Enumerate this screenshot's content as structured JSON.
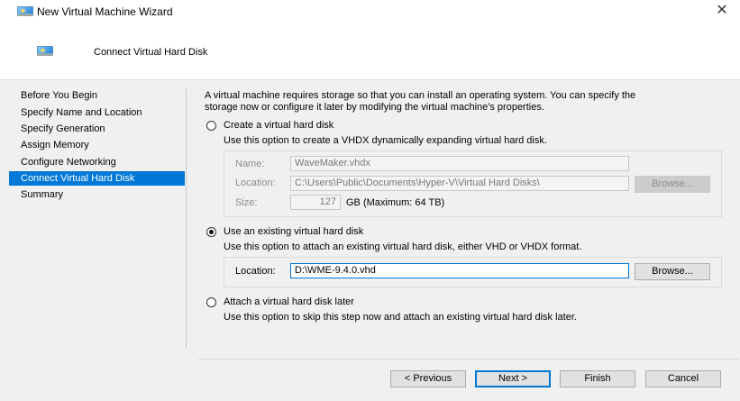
{
  "window": {
    "title": "New Virtual Machine Wizard",
    "close_icon": "close-icon"
  },
  "page_heading": "Connect Virtual Hard Disk",
  "sidebar": {
    "items": [
      {
        "label": "Before You Begin"
      },
      {
        "label": "Specify Name and Location"
      },
      {
        "label": "Specify Generation"
      },
      {
        "label": "Assign Memory"
      },
      {
        "label": "Configure Networking"
      },
      {
        "label": "Connect Virtual Hard Disk",
        "selected": true
      },
      {
        "label": "Summary"
      }
    ]
  },
  "main": {
    "intro_line1": "A virtual machine requires storage so that you can install an operating system. You can specify the",
    "intro_line2": "storage now or configure it later by modifying the virtual machine's properties.",
    "create": {
      "label": "Create a virtual hard disk",
      "selected": false,
      "description": "Use this option to create a VHDX dynamically expanding virtual hard disk.",
      "name_label": "Name:",
      "name_value": "WaveMaker.vhdx",
      "location_label": "Location:",
      "location_value": "C:\\Users\\Public\\Documents\\Hyper-V\\Virtual Hard Disks\\",
      "browse_label": "Browse...",
      "size_label": "Size:",
      "size_value": "127",
      "size_unit": "GB (Maximum: 64 TB)"
    },
    "existing": {
      "label": "Use an existing virtual hard disk",
      "selected": true,
      "description": "Use this option to attach an existing virtual hard disk, either VHD or VHDX format.",
      "location_label": "Location:",
      "location_value": "D:\\WME-9.4.0.vhd",
      "browse_label": "Browse..."
    },
    "later": {
      "label": "Attach a virtual hard disk later",
      "selected": false,
      "description": "Use this option to skip this step now and attach an existing virtual hard disk later."
    }
  },
  "buttons": {
    "previous": "< Previous",
    "next": "Next >",
    "finish": "Finish",
    "cancel": "Cancel"
  },
  "colors": {
    "accent": "#0078d7"
  }
}
